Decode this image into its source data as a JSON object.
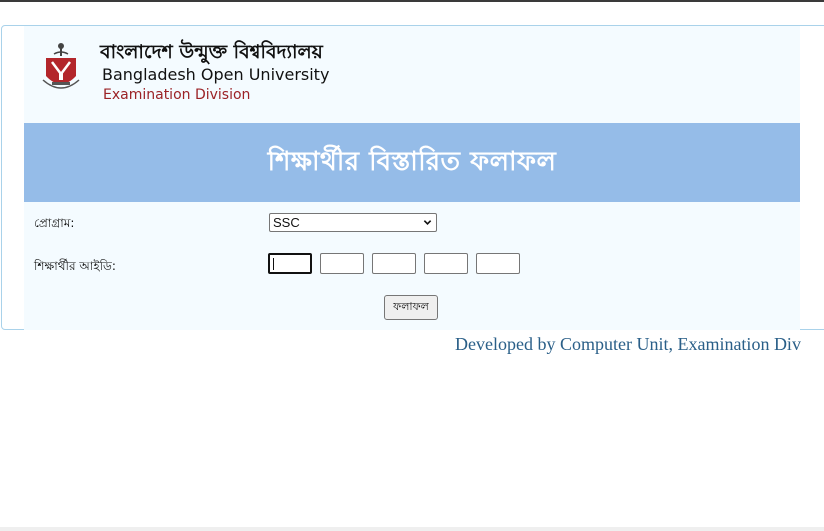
{
  "header": {
    "university_name_bn": "বাংলাদেশ উন্মুক্ত বিশ্ববিদ্যালয়",
    "university_name_en": "Bangladesh Open University",
    "division": "Examination Division",
    "logo_icon": "university-crest-icon",
    "brand_color": "#9b2226"
  },
  "banner": {
    "title": "শিক্ষার্থীর বিস্তারিত ফলাফল",
    "background_color": "#95bce8"
  },
  "form": {
    "program_label": "প্রোগ্রাম:",
    "program_selected": "SSC",
    "student_id_label": "শিক্ষার্থীর আইডি:",
    "id_fields": [
      "",
      "",
      "",
      "",
      ""
    ],
    "submit_label": "ফলাফল"
  },
  "footer": {
    "credit": "Developed by Computer Unit, Examination Div",
    "color": "#2a5f88"
  }
}
